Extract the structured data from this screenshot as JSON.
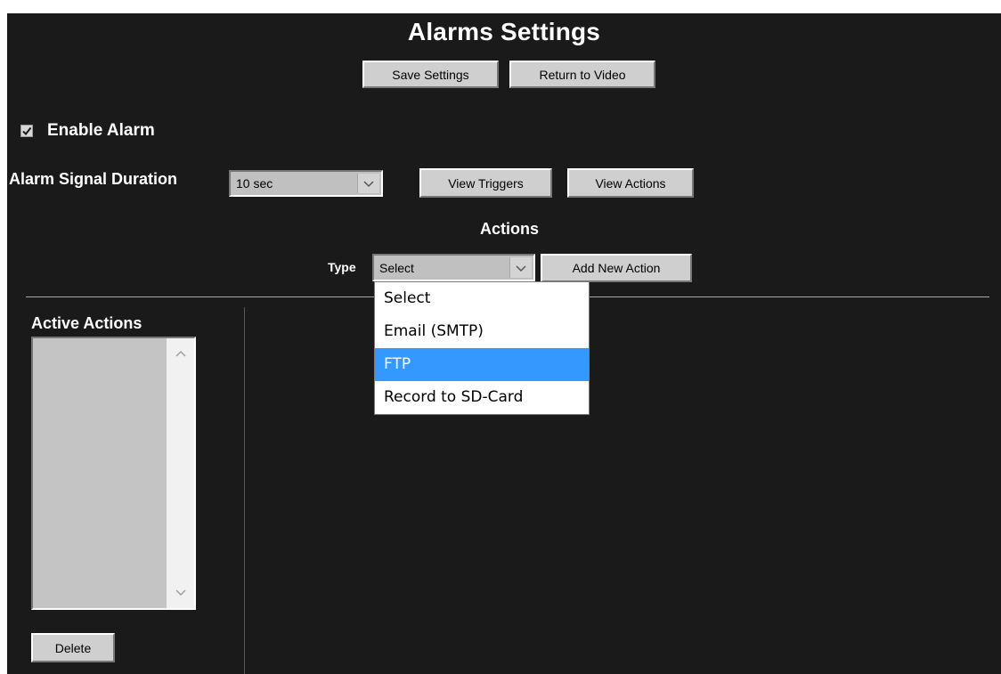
{
  "page": {
    "title": "Alarms Settings"
  },
  "toolbar": {
    "save_label": "Save Settings",
    "return_label": "Return to Video"
  },
  "alarm": {
    "enable_label": "Enable Alarm",
    "enabled": true,
    "duration_label": "Alarm Signal Duration",
    "duration_value": "10 sec",
    "view_triggers_label": "View Triggers",
    "view_actions_label": "View Actions"
  },
  "actions": {
    "heading": "Actions",
    "type_label": "Type",
    "type_value": "Select",
    "add_label": "Add New Action",
    "type_options": [
      {
        "label": "Select",
        "highlighted": false
      },
      {
        "label": "Email (SMTP)",
        "highlighted": false
      },
      {
        "label": "FTP",
        "highlighted": true
      },
      {
        "label": "Record to SD-Card",
        "highlighted": false
      }
    ]
  },
  "active_actions": {
    "label": "Active Actions",
    "items": [],
    "delete_label": "Delete"
  },
  "colors": {
    "background": "#1a1a1a",
    "button_face": "#cfcfcf",
    "highlight": "#3399ff"
  },
  "icons": {
    "checkbox": "checkmark-icon",
    "select_arrow": "chevron-down-icon",
    "scroll_up": "chevron-up-icon",
    "scroll_down": "chevron-down-icon"
  }
}
